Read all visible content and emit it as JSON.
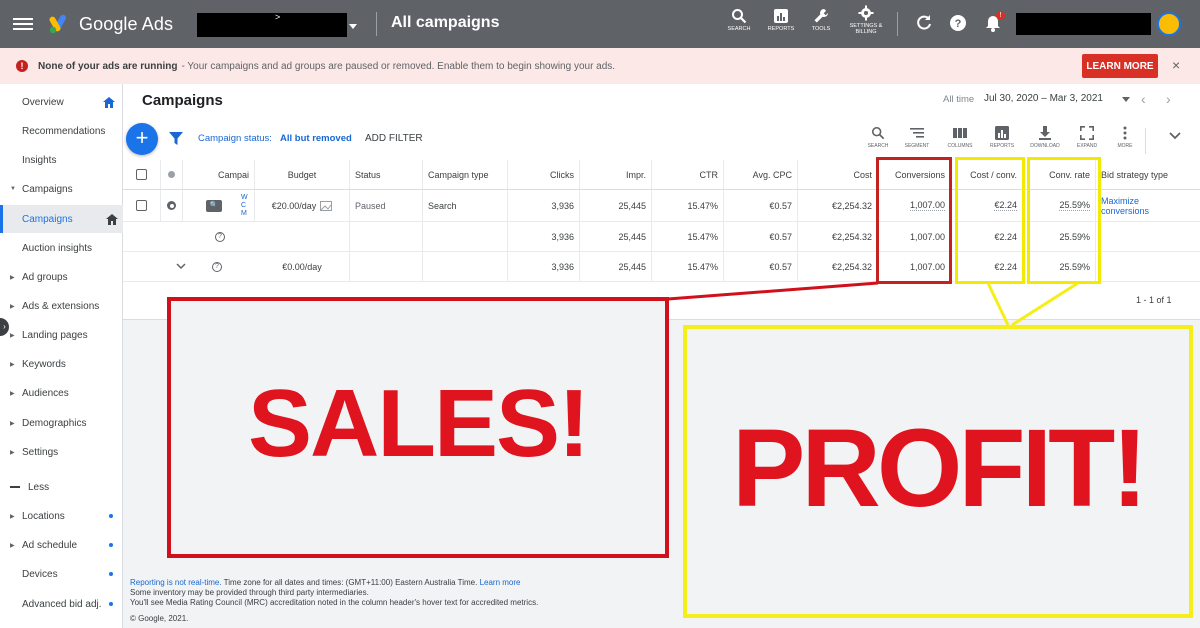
{
  "app": {
    "name": "Google Ads",
    "page_title": "All campaigns"
  },
  "header": {
    "account_chevron": ">",
    "tools": [
      {
        "label": "SEARCH",
        "icon": "search-icon"
      },
      {
        "label": "REPORTS",
        "icon": "reports-icon"
      },
      {
        "label": "TOOLS",
        "icon": "wrench-icon"
      },
      {
        "label": "SETTINGS & BILLING",
        "icon": "gear-icon"
      }
    ],
    "notification_count": "!"
  },
  "alert": {
    "strong": "None of your ads are running",
    "rest": "- Your campaigns and ad groups are paused or removed. Enable them to begin showing your ads.",
    "button": "LEARN MORE",
    "close": "×"
  },
  "sidebar": {
    "items": [
      {
        "label": "Overview"
      },
      {
        "label": "Recommendations"
      },
      {
        "label": "Insights"
      },
      {
        "label": "Campaigns"
      },
      {
        "label": "Campaigns"
      },
      {
        "label": "Auction insights"
      },
      {
        "label": "Ad groups"
      },
      {
        "label": "Ads & extensions"
      },
      {
        "label": "Landing pages"
      },
      {
        "label": "Keywords"
      },
      {
        "label": "Audiences"
      },
      {
        "label": "Demographics"
      },
      {
        "label": "Settings"
      },
      {
        "label": "Less"
      },
      {
        "label": "Locations"
      },
      {
        "label": "Ad schedule"
      },
      {
        "label": "Devices"
      },
      {
        "label": "Advanced bid adj."
      }
    ]
  },
  "main": {
    "title": "Campaigns",
    "date_label": "All time",
    "date_range": "Jul 30, 2020 – Mar 3, 2021",
    "filter_label": "Campaign status:",
    "filter_value": "All but removed",
    "add_filter": "ADD FILTER",
    "toolbar": [
      "SEARCH",
      "SEGMENT",
      "COLUMNS",
      "REPORTS",
      "DOWNLOAD",
      "EXPAND",
      "MORE"
    ],
    "pager": "1 - 1 of 1"
  },
  "table": {
    "headers": {
      "campaign": "Campai",
      "budget": "Budget",
      "status": "Status",
      "type": "Campaign type",
      "clicks": "Clicks",
      "impr": "Impr.",
      "ctr": "CTR",
      "cpc": "Avg. CPC",
      "cost": "Cost",
      "conversions": "Conversions",
      "cost_conv": "Cost / conv.",
      "conv_rate": "Conv. rate",
      "bid": "Bid strategy type"
    },
    "row1": {
      "name": "W C M",
      "budget": "€20.00/day",
      "status": "Paused",
      "type": "Search",
      "clicks": "3,936",
      "impr": "25,445",
      "ctr": "15.47%",
      "cpc": "€0.57",
      "cost": "€2,254.32",
      "conversions": "1,007.00",
      "cost_conv": "€2.24",
      "conv_rate": "25.59%",
      "bid_l1": "Maximize",
      "bid_l2": "conversions"
    },
    "row2": {
      "clicks": "3,936",
      "impr": "25,445",
      "ctr": "15.47%",
      "cpc": "€0.57",
      "cost": "€2,254.32",
      "conversions": "1,007.00",
      "cost_conv": "€2.24",
      "conv_rate": "25.59%"
    },
    "row3": {
      "budget": "€0.00/day",
      "clicks": "3,936",
      "impr": "25,445",
      "ctr": "15.47%",
      "cpc": "€0.57",
      "cost": "€2,254.32",
      "conversions": "1,007.00",
      "cost_conv": "€2.24",
      "conv_rate": "25.59%"
    }
  },
  "overlay": {
    "sales": "SALES!",
    "profit": "PROFIT!"
  },
  "footer": {
    "link1": "Reporting is not real-time.",
    "line1_rest": " Time zone for all dates and times: (GMT+11:00) Eastern Australia Time.",
    "link2": "Learn more",
    "line2": "Some inventory may be provided through third party intermediaries.",
    "line3": "You'll see Media Rating Council (MRC) accreditation noted in the column header's hover text for accredited metrics.",
    "copyright": "© Google, 2021."
  },
  "colors": {
    "topbar": "#5f6368",
    "accent": "#1a73e8",
    "alert_bg": "#fce8e6",
    "red": "#d0101b",
    "yellow": "#f5ee1a"
  }
}
